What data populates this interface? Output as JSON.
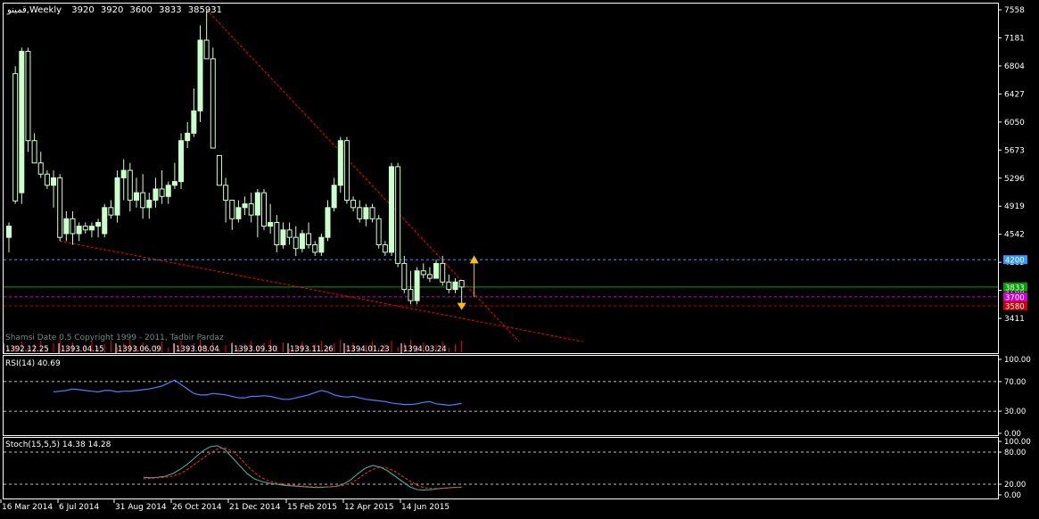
{
  "main_panel": {
    "header": {
      "symbol": "قمینو",
      "timeframe": "Weekly",
      "open": "3920",
      "high": "3920",
      "low": "3600",
      "close": "3833",
      "volume": "385931"
    },
    "price_axis_ticks": [
      "7558",
      "7181",
      "6804",
      "6427",
      "6050",
      "5673",
      "5296",
      "4919",
      "4542",
      "4165",
      "3788",
      "3411"
    ],
    "price_range": [
      3100,
      7600
    ],
    "levels": [
      {
        "name": "level-4200",
        "value": 4200,
        "label": "4200",
        "color": "#3399ff",
        "style": "dashed"
      },
      {
        "name": "level-3833",
        "value": 3833,
        "label": "3833",
        "color": "#00a000",
        "style": "solid"
      },
      {
        "name": "level-3700",
        "value": 3700,
        "label": "3700",
        "color": "#cc00cc",
        "style": "dashed"
      },
      {
        "name": "level-3580",
        "value": 3580,
        "label": "3580",
        "color": "#cc0000",
        "style": "dashed"
      }
    ],
    "watermark": "Shamsi Date 0.5 Copyright 1999 - 2011, Tadbir Pardaz",
    "shamsi_dates": [
      "1392.12.25",
      "1393.04.15",
      "1393.06.09",
      "1393.08.04",
      "1393.09.30",
      "1393.11.26",
      "1394.01.23",
      "1394.03.24"
    ]
  },
  "rsi_panel": {
    "label": "RSI(14) 40.69",
    "axis_ticks": [
      "100.00",
      "70.00",
      "30.00",
      "0.00"
    ],
    "levels": [
      70,
      30
    ]
  },
  "stoch_panel": {
    "label": "Stoch(15,5,5) 14.38 14.28",
    "axis_ticks": [
      "100.00",
      "80.00",
      "20.00",
      "0.00"
    ],
    "levels": [
      80,
      20
    ]
  },
  "x_axis_dates": [
    "16 Mar 2014",
    "6 Jul 2014",
    "31 Aug 2014",
    "26 Oct 2014",
    "21 Dec 2014",
    "15 Feb 2015",
    "12 Apr 2015",
    "14 Jun 2015"
  ],
  "colors": {
    "background": "#000000",
    "candle": "#ccffcc",
    "grid": "#ffffff",
    "trendline": "#ff0000",
    "rsi_line": "#4a7fff",
    "stoch_main": "#38b0a8",
    "stoch_signal": "#ff2020",
    "volume": "#ff0000",
    "arrow": "#ffc000"
  },
  "chart_data": [
    {
      "type": "candlestick",
      "series": [
        {
          "ohlc": [
            [
              4500,
              4700,
              4300,
              4650
            ],
            [
              6700,
              6800,
              4950,
              4990
            ],
            [
              5100,
              7050,
              4950,
              7000
            ],
            [
              7000,
              7050,
              5650,
              5800
            ],
            [
              5800,
              5900,
              5500,
              5500
            ],
            [
              5500,
              5650,
              5300,
              5350
            ],
            [
              5350,
              5400,
              5150,
              5200
            ],
            [
              5200,
              5400,
              4900,
              5300
            ],
            [
              5300,
              5350,
              4450,
              4500
            ],
            [
              4550,
              4850,
              4450,
              4750
            ],
            [
              4750,
              4850,
              4400,
              4550
            ],
            [
              4550,
              4700,
              4450,
              4650
            ],
            [
              4650,
              4700,
              4550,
              4600
            ],
            [
              4600,
              4700,
              4500,
              4650
            ],
            [
              4650,
              4750,
              4500,
              4700
            ],
            [
              4550,
              4950,
              4500,
              4900
            ],
            [
              4900,
              5000,
              4750,
              4800
            ],
            [
              4800,
              5400,
              4700,
              5300
            ],
            [
              5300,
              5550,
              5000,
              5400
            ],
            [
              5400,
              5500,
              4850,
              5000
            ],
            [
              5000,
              5300,
              4900,
              5100
            ],
            [
              5100,
              5350,
              4750,
              4900
            ],
            [
              4900,
              5100,
              4750,
              5000
            ],
            [
              5000,
              5300,
              4900,
              5150
            ],
            [
              5150,
              5400,
              4950,
              5050
            ],
            [
              5050,
              5250,
              4950,
              5200
            ],
            [
              5200,
              5500,
              5150,
              5250
            ],
            [
              5250,
              5900,
              5150,
              5800
            ],
            [
              5800,
              6050,
              5700,
              5900
            ],
            [
              5900,
              6500,
              5850,
              6200
            ],
            [
              6200,
              7350,
              6050,
              7150
            ],
            [
              7150,
              7550,
              6900,
              6900
            ],
            [
              6900,
              7050,
              5700,
              5700
            ],
            [
              5600,
              5300,
              5200,
              5200
            ],
            [
              5200,
              5300,
              4700,
              5000
            ],
            [
              5000,
              5000,
              4600,
              4750
            ],
            [
              4750,
              5000,
              4700,
              4900
            ],
            [
              4900,
              5050,
              4800,
              4950
            ],
            [
              4950,
              5100,
              4700,
              4800
            ],
            [
              4800,
              5150,
              4500,
              5100
            ],
            [
              5100,
              5150,
              4600,
              4650
            ],
            [
              4650,
              4950,
              4550,
              4700
            ],
            [
              4700,
              4800,
              4300,
              4400
            ],
            [
              4400,
              4700,
              4350,
              4600
            ],
            [
              4600,
              4700,
              4400,
              4500
            ],
            [
              4500,
              4650,
              4250,
              4350
            ],
            [
              4350,
              4600,
              4300,
              4550
            ],
            [
              4550,
              4700,
              4350,
              4400
            ],
            [
              4400,
              4450,
              4250,
              4300
            ],
            [
              4300,
              4550,
              4250,
              4500
            ],
            [
              4500,
              5000,
              4450,
              4900
            ],
            [
              4900,
              5300,
              4850,
              5200
            ],
            [
              5200,
              5850,
              5100,
              5800
            ],
            [
              5800,
              5850,
              4950,
              5000
            ],
            [
              5000,
              5050,
              4850,
              4900
            ],
            [
              4900,
              5000,
              4700,
              4750
            ],
            [
              4750,
              4950,
              4650,
              4900
            ],
            [
              4900,
              4950,
              4700,
              4750
            ],
            [
              4750,
              4800,
              4350,
              4400
            ],
            [
              4400,
              4450,
              4250,
              4300
            ],
            [
              4300,
              5500,
              4250,
              5450
            ],
            [
              5450,
              5500,
              4100,
              4150
            ],
            [
              4150,
              4250,
              3750,
              3800
            ],
            [
              3800,
              4050,
              3600,
              3650
            ],
            [
              3650,
              4100,
              3600,
              4050
            ],
            [
              4050,
              4150,
              3950,
              4000
            ],
            [
              4000,
              4100,
              3900,
              3950
            ],
            [
              3950,
              4200,
              3950,
              4150
            ],
            [
              4150,
              4250,
              3850,
              3900
            ],
            [
              3900,
              4000,
              3750,
              3800
            ],
            [
              3800,
              3950,
              3750,
              3900
            ],
            [
              3920,
              3920,
              3600,
              3833
            ]
          ]
        }
      ],
      "trendlines": [
        {
          "from": [
            31,
            7560
          ],
          "to": [
            80,
            3100
          ],
          "style": "dashed"
        },
        {
          "from": [
            8,
            4450
          ],
          "to": [
            90,
            3100
          ],
          "style": "dashed"
        }
      ]
    },
    {
      "type": "line",
      "title": "RSI(14)",
      "series": [
        {
          "name": "RSI",
          "values": [
            56,
            57,
            58,
            60,
            59,
            58,
            57,
            56,
            58,
            58,
            56,
            57,
            57,
            58,
            59,
            60,
            62,
            64,
            68,
            72,
            66,
            60,
            54,
            52,
            52,
            54,
            53,
            52,
            50,
            48,
            48,
            50,
            50,
            51,
            50,
            48,
            46,
            46,
            48,
            50,
            52,
            55,
            58,
            56,
            52,
            50,
            49,
            50,
            48,
            46,
            45,
            44,
            43,
            41,
            40,
            39,
            39,
            40,
            42,
            43,
            40,
            39,
            38,
            39,
            40.69
          ]
        }
      ],
      "ylim": [
        0,
        100
      ]
    },
    {
      "type": "line",
      "title": "Stoch(15,5,5)",
      "series": [
        {
          "name": "Main",
          "values": [
            33,
            32,
            33,
            35,
            40,
            48,
            58,
            70,
            82,
            90,
            92,
            85,
            70,
            55,
            40,
            30,
            25,
            22,
            20,
            18,
            17,
            16,
            15,
            14,
            14,
            15,
            16,
            20,
            28,
            40,
            50,
            55,
            52,
            45,
            35,
            25,
            15,
            10,
            9,
            10,
            12,
            13,
            14,
            14.38
          ]
        },
        {
          "name": "Signal",
          "values": [
            30,
            31,
            32,
            33,
            35,
            40,
            48,
            58,
            68,
            78,
            86,
            88,
            82,
            70,
            55,
            42,
            32,
            26,
            22,
            20,
            18,
            17,
            16,
            15,
            15,
            15,
            16,
            18,
            22,
            30,
            40,
            48,
            52,
            50,
            44,
            35,
            26,
            18,
            13,
            12,
            12,
            13,
            14,
            14.28
          ]
        }
      ],
      "ylim": [
        0,
        100
      ]
    }
  ]
}
